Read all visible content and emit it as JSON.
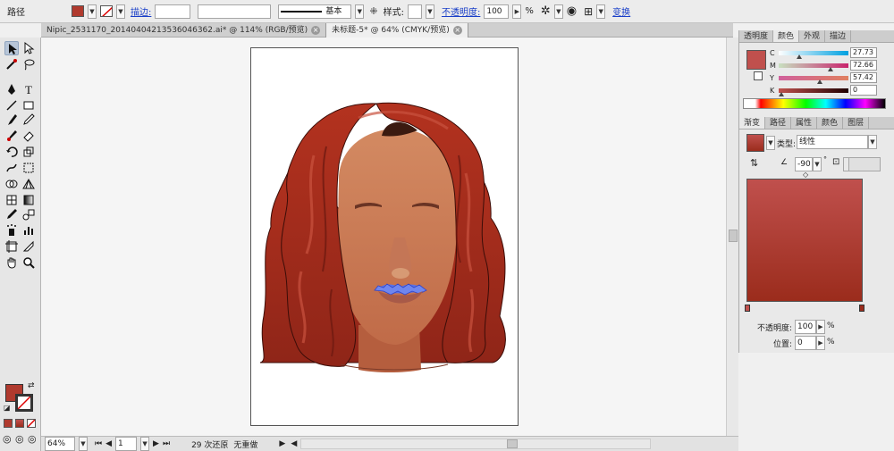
{
  "control_bar": {
    "object_type": "路径",
    "fill_color": "#b03a2e",
    "stroke_label": "描边:",
    "stroke_line_label": "基本",
    "style_label": "样式:",
    "opacity_label": "不透明度:",
    "opacity_value": "100",
    "opacity_unit": "%",
    "transform_label": "变换"
  },
  "doc_tabs": [
    {
      "title": "Nipic_2531170_20140404213536046362.ai* @ 114% (RGB/预览)",
      "active": false
    },
    {
      "title": "未标题-5* @ 64% (CMYK/预览)",
      "active": true
    }
  ],
  "tools": [
    "selection-tool",
    "direct-selection-tool",
    "magic-wand-tool",
    "lasso-tool",
    "pen-tool",
    "type-tool",
    "line-tool",
    "rectangle-tool",
    "paintbrush-tool",
    "pencil-tool",
    "blob-brush-tool",
    "eraser-tool",
    "rotate-tool",
    "scale-tool",
    "warp-tool",
    "free-transform-tool",
    "shape-builder-tool",
    "perspective-grid-tool",
    "mesh-tool",
    "gradient-tool",
    "eyedropper-tool",
    "blend-tool",
    "symbol-sprayer-tool",
    "column-graph-tool",
    "artboard-tool",
    "slice-tool",
    "hand-tool",
    "zoom-tool"
  ],
  "status_bar": {
    "zoom": "64%",
    "page": "1",
    "history": "29 次还原",
    "redo": "无重做"
  },
  "color_panel": {
    "tabs": [
      "透明度",
      "颜色",
      "外观",
      "描边"
    ],
    "active_tab": "颜色",
    "swatch": "#c0504d",
    "channels": [
      {
        "label": "C",
        "value": "27.73"
      },
      {
        "label": "M",
        "value": "72.66"
      },
      {
        "label": "Y",
        "value": "57.42"
      },
      {
        "label": "K",
        "value": "0"
      }
    ]
  },
  "gradient_panel": {
    "tabs": [
      "渐变",
      "路径",
      "属性",
      "颜色",
      "图层"
    ],
    "active_tab": "渐变",
    "type_label": "类型:",
    "type_value": "线性",
    "angle_value": "-90",
    "start_color": "#c0504d",
    "end_color": "#9b2c1c",
    "opacity_label": "不透明度:",
    "opacity_value": "100",
    "opacity_unit": "%",
    "position_label": "位置:",
    "position_value": "0",
    "position_unit": "%"
  },
  "colors": {
    "hair": "#a52b1e",
    "hair_dark": "#7a1c13",
    "skin": "#c87a56",
    "skin_light": "#d9956c",
    "lips": "#a85a48",
    "selection": "#5a73e8"
  }
}
